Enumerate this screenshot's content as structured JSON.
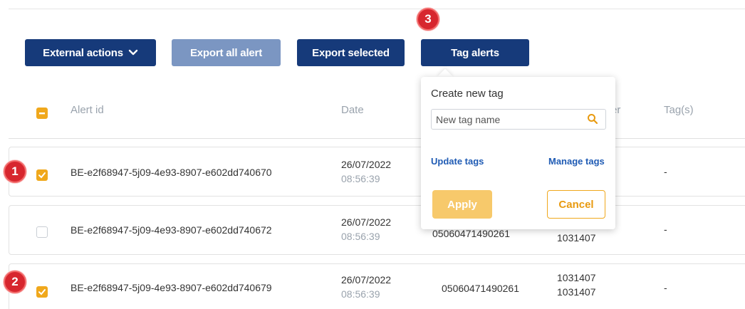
{
  "toolbar": {
    "external_actions": "External actions",
    "export_all": "Export all alert",
    "export_selected": "Export selected",
    "tag_alerts": "Tag alerts"
  },
  "badges": [
    "1",
    "2",
    "3"
  ],
  "table": {
    "headers": {
      "alert_id": "Alert id",
      "date": "Date",
      "er": "er",
      "tags": "Tag(s)"
    },
    "rows": [
      {
        "checked": true,
        "alert_id": "BE-e2f68947-5j09-4e93-8907-e602dd740670",
        "date": "26/07/2022",
        "time": "08:56:39",
        "tags": "-"
      },
      {
        "checked": false,
        "alert_id": "BE-e2f68947-5j09-4e93-8907-e602dd740672",
        "date": "26/07/2022",
        "time": "08:56:39",
        "col3": "05060471490261",
        "col4": "1031407",
        "tags": "-"
      },
      {
        "checked": true,
        "alert_id": "BE-e2f68947-5j09-4e93-8907-e602dd740679",
        "date": "26/07/2022",
        "time": "08:56:39",
        "col3": "05060471490261",
        "col4a": "1031407",
        "col4b": "1031407",
        "tags": "-"
      }
    ]
  },
  "popup": {
    "title": "Create new tag",
    "input_placeholder": "New tag name",
    "update_tags": "Update tags",
    "manage_tags": "Manage tags",
    "apply": "Apply",
    "cancel": "Cancel"
  },
  "colors": {
    "primary": "#163a7a",
    "accent": "#f0a81c",
    "badge": "#d7262e",
    "link": "#1f5bb4"
  }
}
